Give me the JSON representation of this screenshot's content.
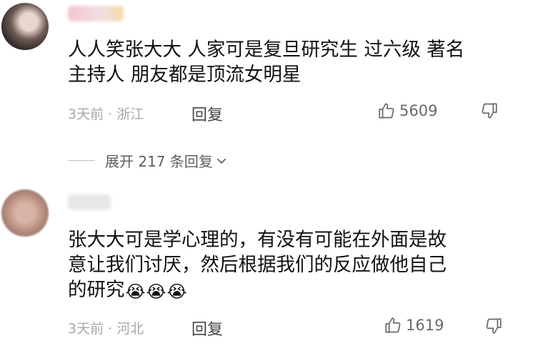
{
  "comments": [
    {
      "text_line1": "人人笑张大大 人家可是复旦研究生 过六级 著名",
      "text_line2": "主持人 朋友都是顶流女明星",
      "meta": "3天前 · 浙江",
      "reply_label": "回复",
      "likes": "5609"
    },
    {
      "text_line1": "张大大可是学心理的，有没有可能在外面是故",
      "text_line2": "意让我们讨厌，然后根据我们的反应做他自己",
      "text_line3": "的研究",
      "emojis": [
        "😭",
        "😭",
        "😭"
      ],
      "meta": "3天前 · 河北",
      "reply_label": "回复",
      "likes": "1619"
    }
  ],
  "expand_replies": "展开 217 条回复",
  "icons": {
    "like": "thumbs-up-icon",
    "dislike": "thumbs-down-icon",
    "expand": "chevron-down-icon",
    "crying_emoji": "loudly-crying-face-icon"
  },
  "colors": {
    "meta_text": "#a7a7a7",
    "body_text": "#111111",
    "secondary_text": "#5f5f5f"
  }
}
